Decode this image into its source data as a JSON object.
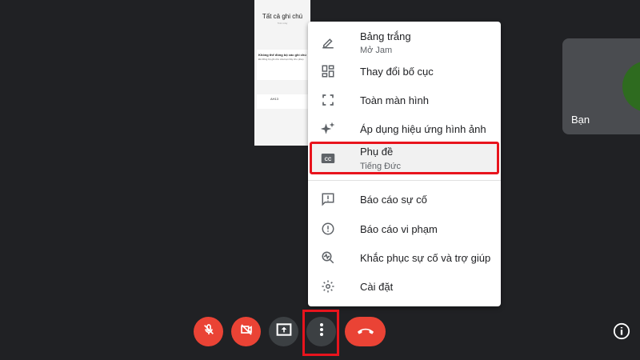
{
  "shared_screen": {
    "title": "Tất cả ghi chú",
    "subtitle": "Trên mây",
    "card_title": "Không thể đồng bộ các ghi chú",
    "card_text": "Để đồng bộ ghi chú của bạn hãy cho phép",
    "note_title": "AH13"
  },
  "self_tile": {
    "name": "Bạn",
    "avatar_color": "#2e6b1f"
  },
  "menu": {
    "items": [
      {
        "label": "Bảng trắng",
        "sub": "Mở Jam",
        "icon": "pencil-icon"
      },
      {
        "label": "Thay đổi bố cục",
        "icon": "layout-icon"
      },
      {
        "label": "Toàn màn hình",
        "icon": "fullscreen-icon"
      },
      {
        "label": "Áp dụng hiệu ứng hình ảnh",
        "icon": "sparkle-icon"
      },
      {
        "label": "Phụ đề",
        "sub": "Tiếng Đức",
        "icon": "closed-caption-icon",
        "highlighted": true
      },
      {
        "label": "Báo cáo sự cố",
        "icon": "feedback-icon"
      },
      {
        "label": "Báo cáo vi phạm",
        "icon": "report-icon"
      },
      {
        "label": "Khắc phục sự cố và trợ giúp",
        "icon": "troubleshoot-icon"
      },
      {
        "label": "Cài đặt",
        "icon": "gear-icon"
      }
    ]
  },
  "controls": [
    "mic-off",
    "camera-off",
    "present-screen",
    "more-options",
    "end-call"
  ],
  "colors": {
    "background": "#202124",
    "danger": "#ea4335",
    "highlight": "#e8141d"
  }
}
